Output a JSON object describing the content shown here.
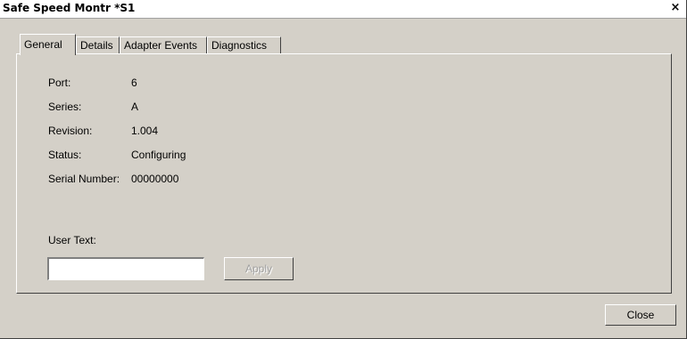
{
  "window": {
    "title": "Safe Speed Montr  *S1",
    "close_glyph": "×",
    "close_icon": "close-icon"
  },
  "tabs": [
    {
      "label": "General",
      "active": true
    },
    {
      "label": "Details",
      "active": false
    },
    {
      "label": "Adapter Events",
      "active": false
    },
    {
      "label": "Diagnostics",
      "active": false
    }
  ],
  "general": {
    "fields": [
      {
        "label": "Port:",
        "value": "6"
      },
      {
        "label": "Series:",
        "value": "A"
      },
      {
        "label": "Revision:",
        "value": "1.004"
      },
      {
        "label": "Status:",
        "value": "Configuring"
      },
      {
        "label": "Serial Number:",
        "value": "00000000"
      }
    ],
    "user_text_label": "User Text:",
    "user_text_value": "",
    "apply_label": "Apply",
    "apply_enabled": false
  },
  "footer": {
    "close_label": "Close"
  }
}
